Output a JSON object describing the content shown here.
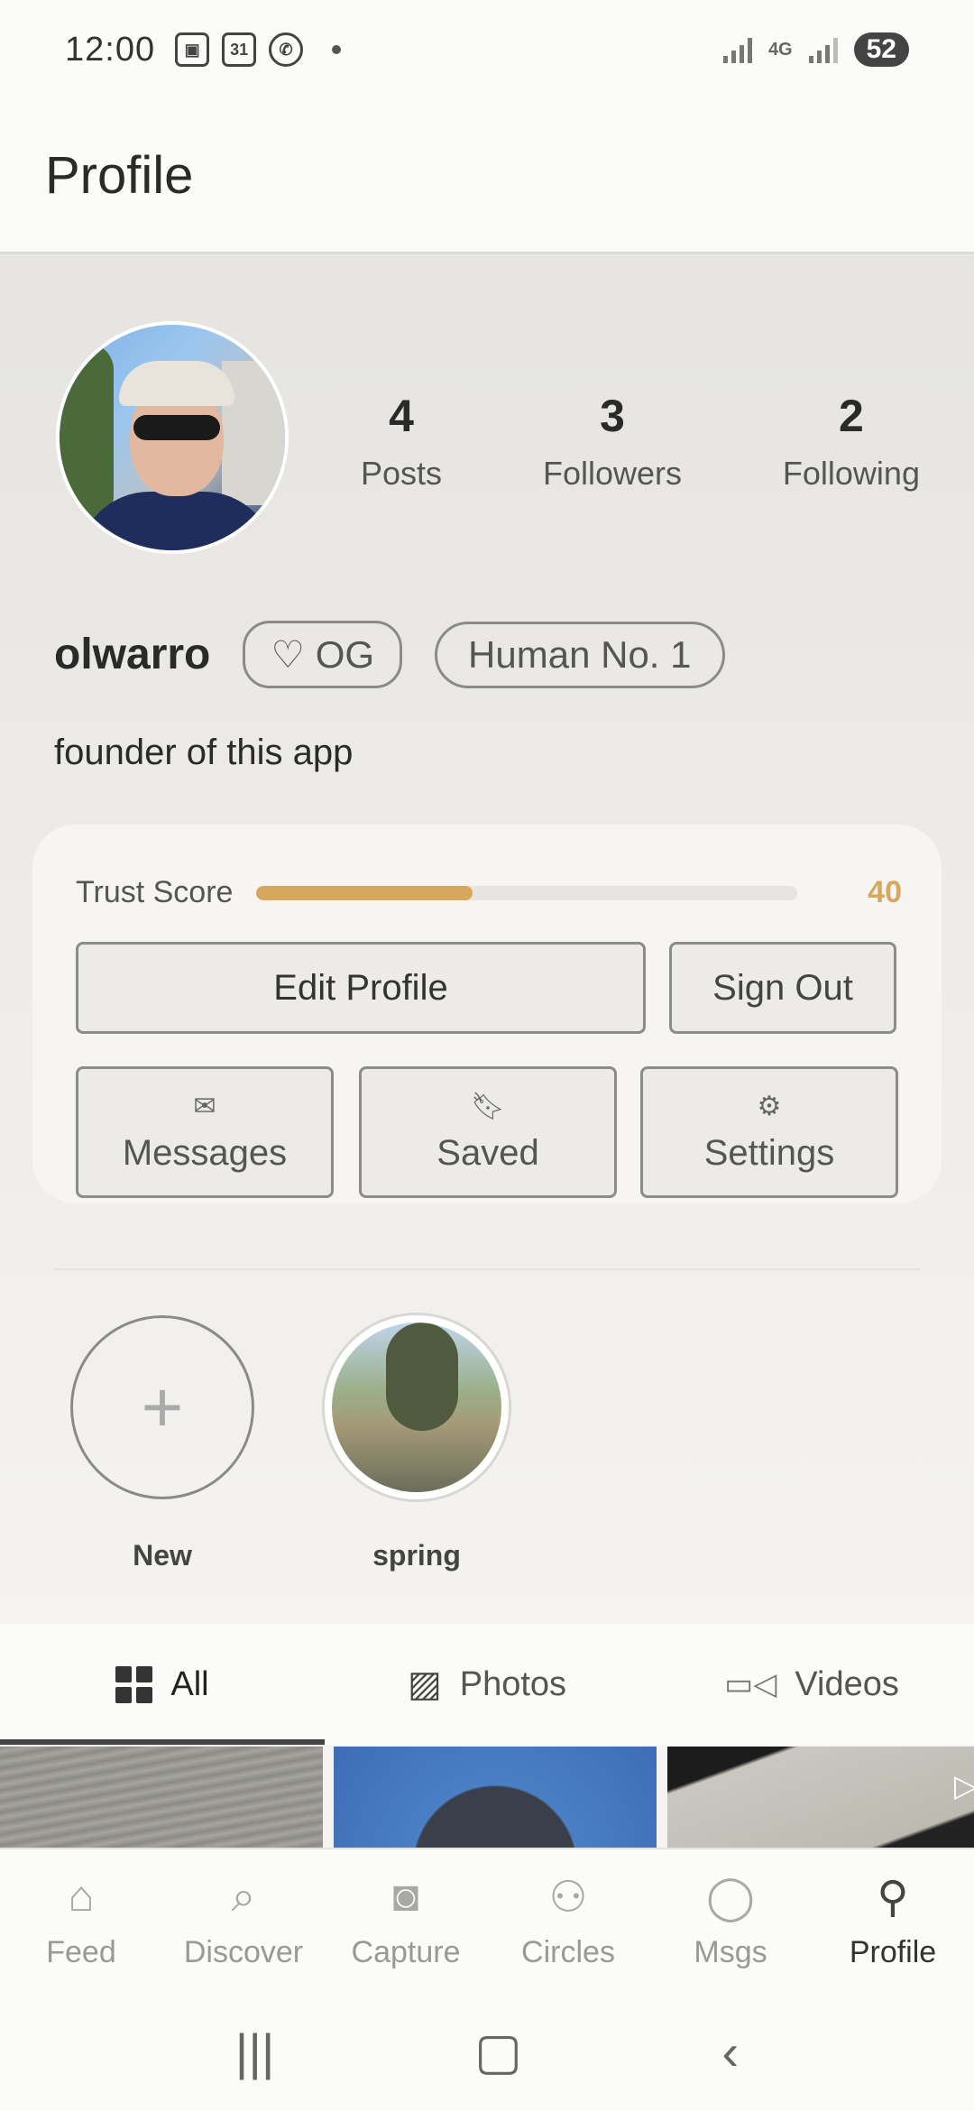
{
  "status_bar": {
    "time": "12:00",
    "calendar_day": "31",
    "battery": "52",
    "network": "4G"
  },
  "header": {
    "title": "Profile"
  },
  "profile": {
    "username": "olwarro",
    "badges": [
      "♡ OG",
      "Human No. 1"
    ],
    "bio": "founder of this app",
    "stats": [
      {
        "value": "4",
        "label": "Posts"
      },
      {
        "value": "3",
        "label": "Followers"
      },
      {
        "value": "2",
        "label": "Following"
      }
    ]
  },
  "trust": {
    "label": "Trust Score",
    "value": "40",
    "fraction": 0.4,
    "color": "#d6a75c"
  },
  "actions": {
    "edit_profile": "Edit Profile",
    "sign_out": "Sign Out",
    "messages": "Messages",
    "saved": "Saved",
    "settings": "Settings"
  },
  "stories": [
    {
      "label": "New",
      "icon": "plus-icon"
    },
    {
      "label": "spring",
      "icon": "story-thumbnail"
    }
  ],
  "tabs": [
    {
      "label": "All",
      "icon": "grid-icon",
      "active": true
    },
    {
      "label": "Photos",
      "icon": "image-icon",
      "active": false
    },
    {
      "label": "Videos",
      "icon": "video-icon",
      "active": false
    }
  ],
  "bottom_nav": [
    {
      "label": "Feed",
      "icon": "home-icon"
    },
    {
      "label": "Discover",
      "icon": "search-icon"
    },
    {
      "label": "Capture",
      "icon": "camera-icon"
    },
    {
      "label": "Circles",
      "icon": "people-icon"
    },
    {
      "label": "Msgs",
      "icon": "chat-icon"
    },
    {
      "label": "Profile",
      "icon": "user-icon",
      "active": true
    }
  ]
}
